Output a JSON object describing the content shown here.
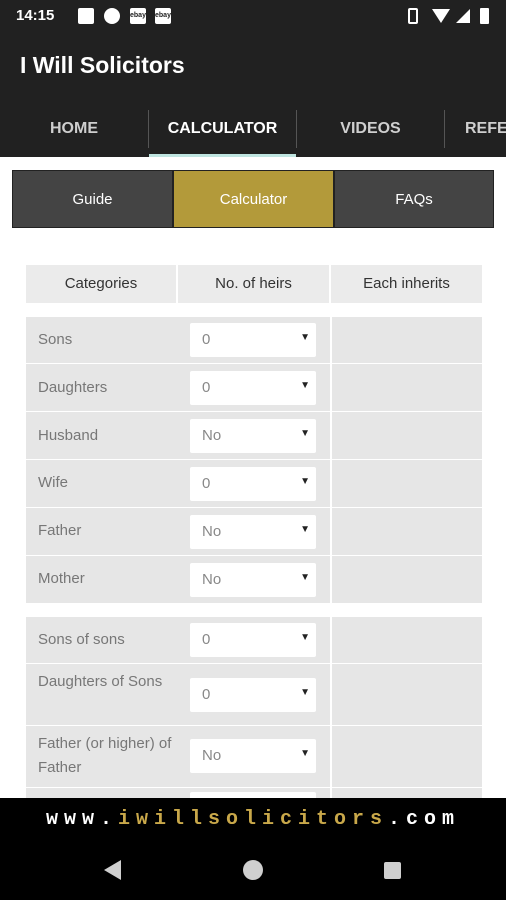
{
  "status": {
    "time": "14:15",
    "notif_icons": [
      "image-icon",
      "telegram-icon",
      "ebay-icon",
      "ebay-icon"
    ],
    "ebay_label": "ebay"
  },
  "app": {
    "title": "I Will Solicitors"
  },
  "tabs": [
    {
      "label": "HOME"
    },
    {
      "label": "CALCULATOR"
    },
    {
      "label": "VIDEOS"
    },
    {
      "label": "REFE"
    }
  ],
  "segments": [
    {
      "label": "Guide"
    },
    {
      "label": "Calculator"
    },
    {
      "label": "FAQs"
    }
  ],
  "table": {
    "headers": [
      "Categories",
      "No. of heirs",
      "Each inherits"
    ],
    "group1": [
      {
        "label": "Sons",
        "value": "0"
      },
      {
        "label": "Daughters",
        "value": "0"
      },
      {
        "label": "Husband",
        "value": "No"
      },
      {
        "label": "Wife",
        "value": "0"
      },
      {
        "label": "Father",
        "value": "No"
      },
      {
        "label": "Mother",
        "value": "No"
      }
    ],
    "group2": [
      {
        "label": "Sons of sons",
        "value": "0"
      },
      {
        "label": "Daughters of Sons",
        "value": "0"
      },
      {
        "label": "Father (or higher) of Father",
        "value": "No"
      }
    ]
  },
  "footer": {
    "prefix": "www.",
    "domain": "iwillsolicitors",
    "suffix": ".com"
  },
  "colors": {
    "accent": "#b39a3a",
    "dark": "#212121"
  }
}
